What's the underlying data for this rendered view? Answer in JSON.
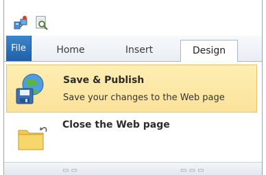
{
  "quick_access": {
    "icons": [
      "web-database-icon",
      "print-preview-icon"
    ]
  },
  "ribbon": {
    "tabs": [
      {
        "label": "File"
      },
      {
        "label": "Home"
      },
      {
        "label": "Insert"
      },
      {
        "label": "Design"
      }
    ],
    "active_tab": "Design"
  },
  "menu": {
    "items": [
      {
        "title": "Save & Publish",
        "description": "Save your changes to the Web page",
        "icon": "save-publish-icon",
        "highlighted": true
      },
      {
        "title": "Close the Web page",
        "icon": "close-folder-icon",
        "highlighted": false
      }
    ]
  },
  "colors": {
    "file_tab": "#2a6fb8",
    "highlight": "#fbe29a",
    "highlight_border": "#e6c56a"
  }
}
